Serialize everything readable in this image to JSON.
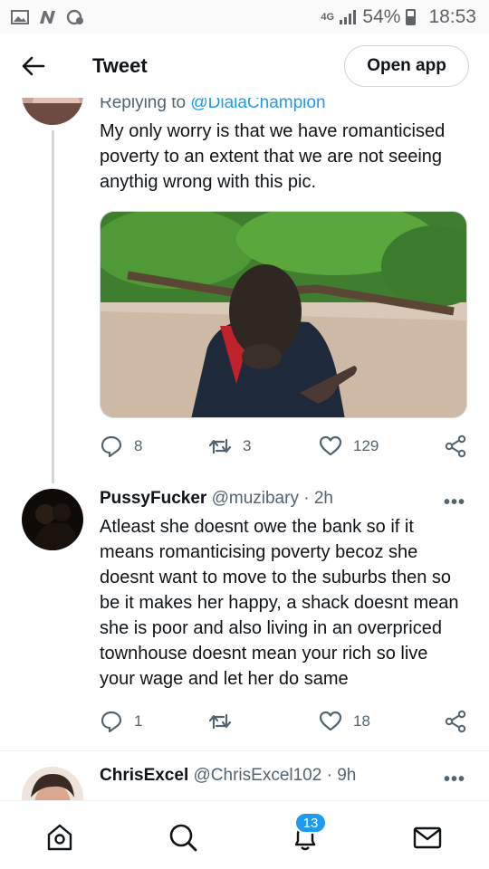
{
  "status_bar": {
    "network": "4G",
    "battery": "54%",
    "battery_level": 0.54,
    "time": "18:53",
    "icons": [
      "gallery-icon",
      "n-app-icon",
      "sync-icon",
      "signal-icon",
      "battery-icon"
    ]
  },
  "header": {
    "title": "Tweet",
    "open_app_label": "Open app"
  },
  "tweets": [
    {
      "reply_prefix": "Replying to",
      "reply_mention": "@DialaChampion",
      "text": "My only worry is that we have romanticised poverty to an extent that we are not seeing anythig wrong with this pic.",
      "has_media": true,
      "replies": "8",
      "retweets": "3",
      "likes": "129"
    },
    {
      "name": "PussyFucker",
      "handle": "@muzibary",
      "time": "· 2h",
      "text": "Atleast she doesnt owe the bank so if it means romanticising poverty becoz she doesnt want to move to the suburbs then so be it makes her happy, a shack doesnt mean she is poor and also living in an overpriced townhouse doesnt mean your rich so live your wage and let her do same",
      "replies": "1",
      "retweets": "",
      "likes": "18"
    },
    {
      "name": "ChrisExcel",
      "handle": "@ChrisExcel102",
      "time": "· 9h"
    }
  ],
  "more_glyph": "•••",
  "bottom_nav": {
    "notification_count": "13",
    "items": [
      "home-icon",
      "search-icon",
      "notifications-icon",
      "messages-icon"
    ]
  },
  "colors": {
    "accent": "#1d9bf0",
    "text": "#0f1419",
    "secondary": "#536471",
    "border": "#cfd9de"
  }
}
